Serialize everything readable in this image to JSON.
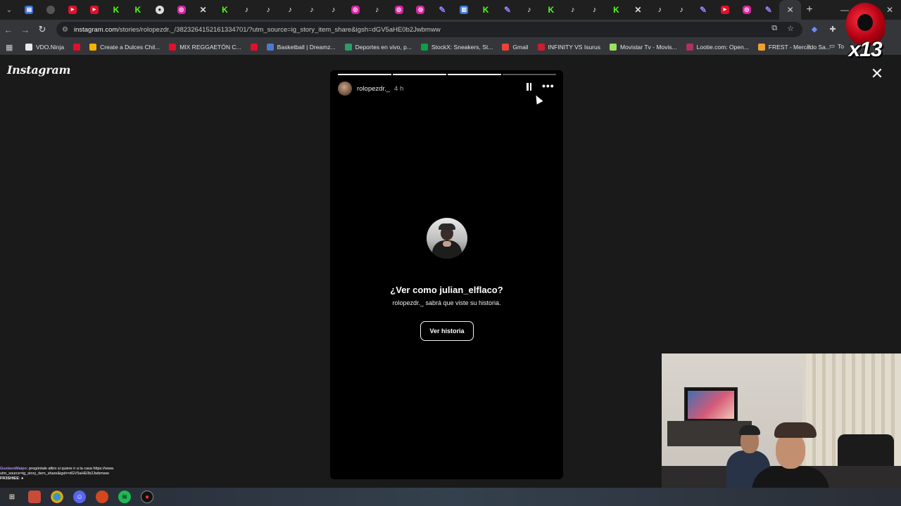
{
  "browser": {
    "tabs": [
      {
        "icon": "ms-icon",
        "type": "blue",
        "glyph": "▤"
      },
      {
        "icon": "globe-icon",
        "type": "gray",
        "glyph": ""
      },
      {
        "icon": "youtube-icon",
        "type": "yt",
        "glyph": "▶"
      },
      {
        "icon": "youtube-icon",
        "type": "yt",
        "glyph": "▶"
      },
      {
        "icon": "kick-icon",
        "type": "k",
        "glyph": "K"
      },
      {
        "icon": "kick-icon",
        "type": "k",
        "glyph": "K"
      },
      {
        "icon": "github-icon",
        "type": "gh",
        "glyph": "●"
      },
      {
        "icon": "instagram-icon",
        "type": "ig",
        "glyph": "◎"
      },
      {
        "icon": "x-icon",
        "type": "x",
        "glyph": "✕"
      },
      {
        "icon": "kick-icon",
        "type": "k",
        "glyph": "K"
      },
      {
        "icon": "tiktok-icon",
        "type": "tt",
        "glyph": "♪"
      },
      {
        "icon": "tiktok-icon",
        "type": "tt",
        "glyph": "♪"
      },
      {
        "icon": "tiktok-icon",
        "type": "tt",
        "glyph": "♪"
      },
      {
        "icon": "tiktok-icon",
        "type": "tt",
        "glyph": "♪"
      },
      {
        "icon": "tiktok-icon",
        "type": "tt",
        "glyph": "♪"
      },
      {
        "icon": "instagram-icon",
        "type": "ig",
        "glyph": "◎"
      },
      {
        "icon": "tiktok-icon",
        "type": "tt",
        "glyph": "♪"
      },
      {
        "icon": "instagram-icon",
        "type": "ig",
        "glyph": "◎"
      },
      {
        "icon": "instagram-icon",
        "type": "ig",
        "glyph": "◎"
      },
      {
        "icon": "feather-icon",
        "type": "feather",
        "glyph": "✎"
      },
      {
        "icon": "chart-icon",
        "type": "chart",
        "glyph": "▥"
      },
      {
        "icon": "kick-icon",
        "type": "k",
        "glyph": "K"
      },
      {
        "icon": "feather-icon",
        "type": "feather",
        "glyph": "✎"
      },
      {
        "icon": "tiktok-icon",
        "type": "tt",
        "glyph": "♪"
      },
      {
        "icon": "kick-icon",
        "type": "k",
        "glyph": "K"
      },
      {
        "icon": "tiktok-icon",
        "type": "tt",
        "glyph": "♪"
      },
      {
        "icon": "tiktok-icon",
        "type": "tt",
        "glyph": "♪"
      },
      {
        "icon": "kick-icon",
        "type": "k",
        "glyph": "K"
      },
      {
        "icon": "x-icon",
        "type": "x",
        "glyph": "✕"
      },
      {
        "icon": "tiktok-icon",
        "type": "tt",
        "glyph": "♪"
      },
      {
        "icon": "tiktok-icon",
        "type": "tt",
        "glyph": "♪"
      },
      {
        "icon": "feather-icon",
        "type": "feather",
        "glyph": "✎"
      },
      {
        "icon": "youtube-icon",
        "type": "yt",
        "glyph": "▶"
      },
      {
        "icon": "instagram-icon",
        "type": "ig",
        "glyph": "◎"
      },
      {
        "icon": "feather-icon",
        "type": "feather",
        "glyph": "✎"
      }
    ],
    "active_tab_close": "✕",
    "new_tab": "+",
    "url_host": "instagram.com",
    "url_path": "/stories/rolopezdr._/3823264152161334701/?utm_source=ig_story_item_share&igsh=dGV5aHE0b2Jwbmww",
    "bookmarks": [
      {
        "label": "VDO.Ninja",
        "color": "#e9e9e9"
      },
      {
        "label": "",
        "color": "#e0102a"
      },
      {
        "label": "Create a Dulces Chil...",
        "color": "#f4b400"
      },
      {
        "label": "MIX REGGAETÓN C...",
        "color": "#e0102a"
      },
      {
        "label": "",
        "color": "#e0102a"
      },
      {
        "label": "Basketball | Dreamz...",
        "color": "#4a7bd0"
      },
      {
        "label": "Deportes en vivo, p...",
        "color": "#2d9c6a"
      },
      {
        "label": "StockX: Sneakers, St...",
        "color": "#0b9f4a"
      },
      {
        "label": "Gmail",
        "color": "#ea4335"
      },
      {
        "label": "INFINITY VS Isurus",
        "color": "#c81e2e"
      },
      {
        "label": "Movistar Tv - Movis...",
        "color": "#9be15d"
      },
      {
        "label": "Lootie.com: Open...",
        "color": "#b03060"
      },
      {
        "label": "FREST - Mercado Sa...",
        "color": "#f0a030"
      }
    ],
    "bookmarks_more": "»",
    "bookmarks_folder": "To"
  },
  "page": {
    "logo": "Instagram",
    "close": "✕"
  },
  "story": {
    "segments": [
      true,
      true,
      true,
      false
    ],
    "username": "rolopezdr._",
    "time": "4 h",
    "more": "•••",
    "prompt_title": "¿Ver como julian_elflaco?",
    "prompt_sub": "rolopezdr._ sabrá que viste su historia.",
    "button": "Ver historia"
  },
  "overlay": {
    "badge_text": "x13",
    "chat": [
      {
        "user": "GustavoMaipo",
        "text": ": pregúntale altiro si quiere ir a la casa https://www. utm_source=ig_story_item_share&igsh=dGV5aHE0b2Jwbmww"
      },
      {
        "user": "FR3SHIEE",
        "text": ": ●"
      }
    ]
  }
}
